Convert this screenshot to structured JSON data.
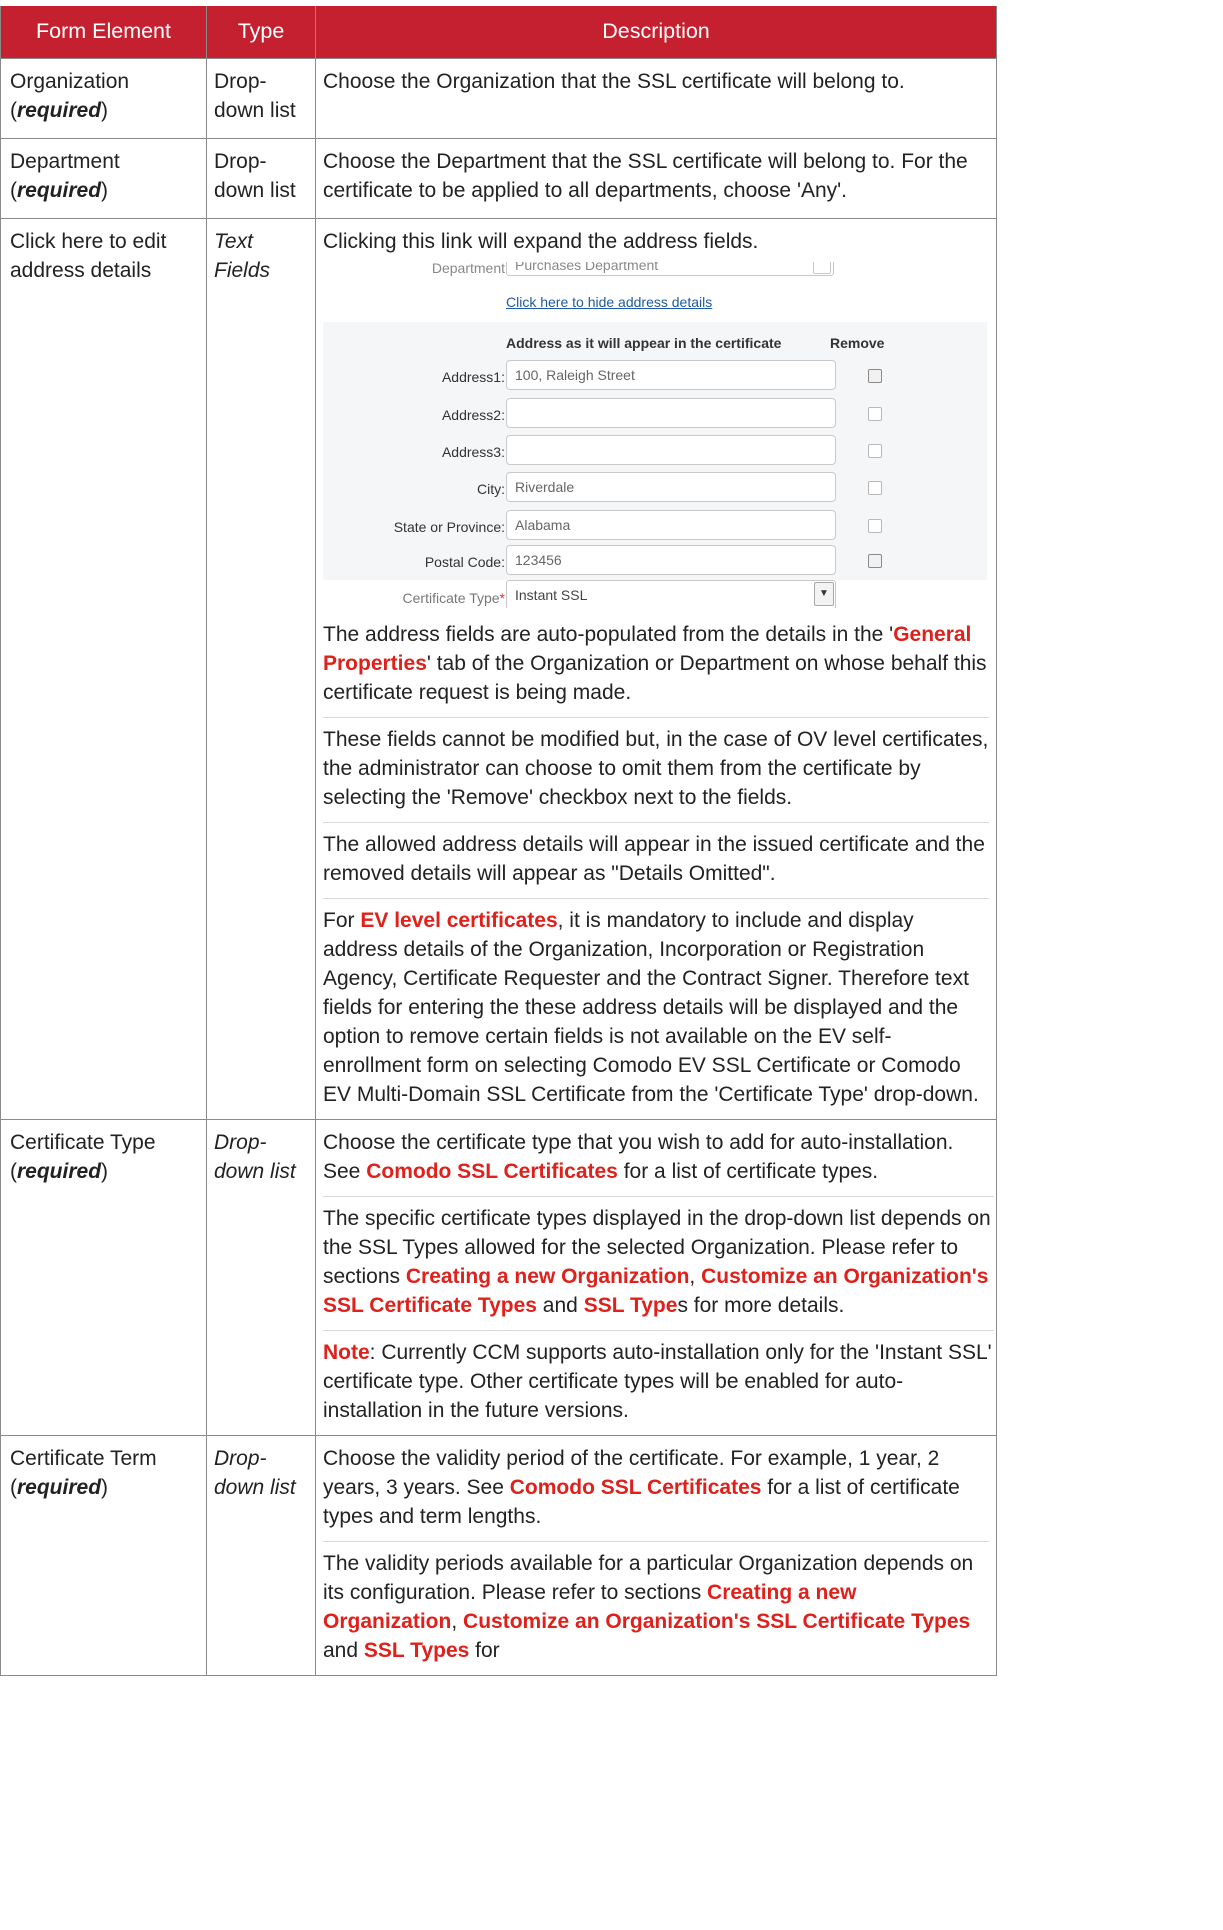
{
  "table": {
    "headers": [
      "Form Element",
      "Type",
      "Description"
    ],
    "rows": {
      "org": {
        "element": "Organization",
        "required": "required",
        "type": "Drop-down list",
        "desc": "Choose the Organization that the SSL certificate will belong to."
      },
      "dept": {
        "element": "Department (",
        "required": "required",
        "type": "Drop-down list",
        "desc": "Choose the Department that the SSL certificate will belong to. For the certificate to be applied to all departments, choose 'Any'."
      },
      "addr": {
        "element": "Click here to edit address details",
        "type": "Text Fields",
        "intro": "Clicking this link will expand the address fields.",
        "p1_a": "The address fields are auto-populated from the details in the '",
        "p1_link": "General Properties",
        "p1_b": "' tab of the Organization or Department on whose behalf this certificate request is being made.",
        "p2": "These fields cannot be modified but, in the case of OV level certificates, the administrator can choose to omit them from the certificate by selecting the 'Remove' checkbox next to the fields.",
        "p3": "The allowed address details will appear in the issued certificate and the removed details will appear as \"Details Omitted\".",
        "p4_a": "For ",
        "p4_link": "EV level certificates",
        "p4_b": ", it is mandatory to include and display address details of the Organization, Incorporation or Registration Agency, Certificate Requester and the Contract Signer. Therefore text fields for entering the these address details will be displayed and the option to remove certain fields is not available on the EV self-enrollment form on selecting Comodo EV SSL Certificate or Comodo EV Multi-Domain SSL Certificate from the 'Certificate Type' drop-down."
      },
      "ctype": {
        "element": "Certificate Type",
        "required": "required",
        "type": "Drop-down list",
        "p1_a": "Choose the certificate type that you wish to add for auto-installation. See ",
        "p1_link": "Comodo SSL Certificates",
        "p1_b": " for a list of certificate types.",
        "p2_a": "The specific certificate types displayed in the drop-down list depends on the SSL Types allowed for the selected Organization. Please refer to sections ",
        "p2_link1": "Creating a new Organization",
        "p2_comma": ", ",
        "p2_link2": "Customize an Organization's SSL Certificate Types",
        "p2_and": " and ",
        "p2_link3": "SSL Type",
        "p2_b": "s for more details.",
        "note_link": "Note",
        "note_text": ": Currently CCM supports auto-installation only for the 'Instant SSL' certificate type. Other certificate types will be enabled for auto-installation in the future versions."
      },
      "cterm": {
        "element": "Certificate Term",
        "required": "required",
        "type": "Drop-down list",
        "p1_a": "Choose the validity period of the certificate. For example, 1 year, 2 years, 3 years. See ",
        "p1_link": "Comodo SSL Certificates",
        "p1_b": " for a list of certificate types and term lengths.",
        "p2_a": "The validity periods available for a particular Organization depends on its configuration. Please refer to sections ",
        "p2_link1": "Creating a new Organization",
        "p2_comma": ",",
        "p2_link2": "Customize an Organization's SSL Certificate Types",
        "p2_and": " and ",
        "p2_link3": "SSL Types",
        "p2_b": " for"
      }
    }
  },
  "screenshot": {
    "department_label": "Department",
    "department_value": "Purchases Department",
    "hide_link": "Click here to hide address details",
    "address_header": "Address as it will appear in the certificate",
    "remove_header": "Remove",
    "fields": [
      {
        "label": "Address1:",
        "value": "100, Raleigh Street",
        "removable": true
      },
      {
        "label": "Address2:",
        "value": "",
        "removable": false
      },
      {
        "label": "Address3:",
        "value": "",
        "removable": false
      },
      {
        "label": "City:",
        "value": "Riverdale",
        "removable": false
      },
      {
        "label": "State or Province:",
        "value": "Alabama",
        "removable": false
      },
      {
        "label": "Postal Code:",
        "value": "123456",
        "removable": true
      }
    ],
    "cert_type_label": "Certificate Type",
    "cert_type_required_mark": "*",
    "cert_type_value": "Instant SSL"
  },
  "colors": {
    "header_bg": "#c5202f",
    "link": "#e0201b",
    "screenshot_link": "#1f5aa6"
  }
}
